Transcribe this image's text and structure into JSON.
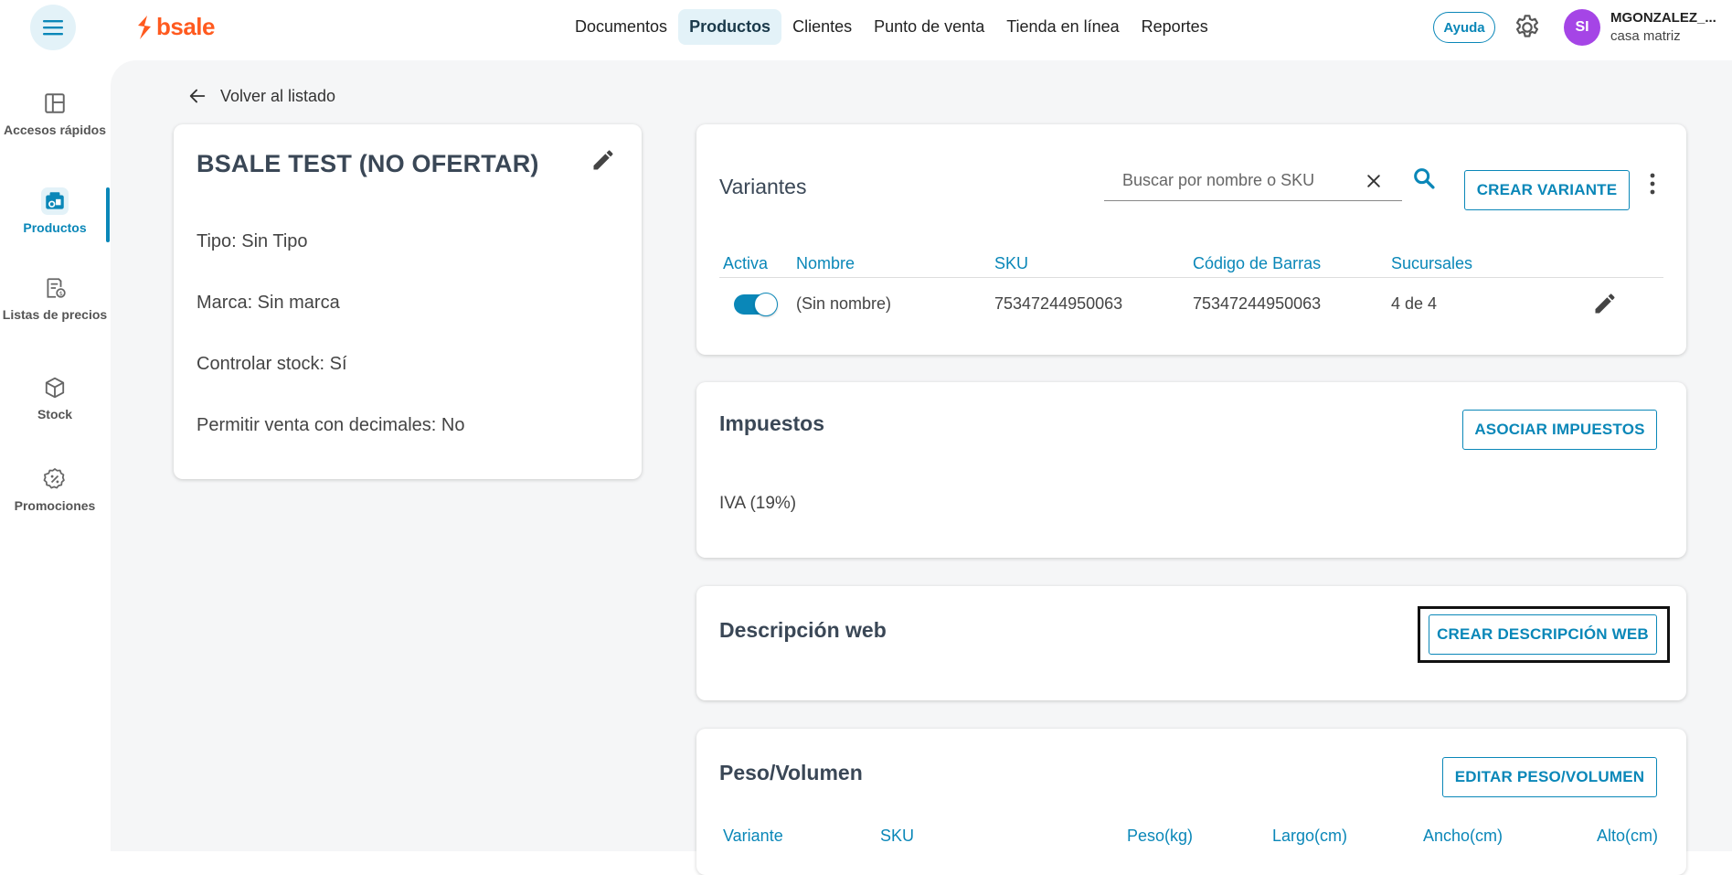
{
  "app": {
    "logo_text": "bsale",
    "brand_color": "#ff5a1f",
    "accent_color": "#0a87b8"
  },
  "topnav": {
    "items": [
      "Documentos",
      "Productos",
      "Clientes",
      "Punto de venta",
      "Tienda en línea",
      "Reportes"
    ],
    "active": "Productos"
  },
  "header": {
    "help_label": "Ayuda",
    "avatar_initials": "SI",
    "user_name": "MGONZALEZ_...",
    "user_branch": "casa matriz"
  },
  "sidebar": {
    "items": [
      {
        "label": "Accesos rápidos",
        "icon": "layout-icon"
      },
      {
        "label": "Productos",
        "icon": "products-icon",
        "active": true
      },
      {
        "label": "Listas de precios",
        "icon": "price-list-icon"
      },
      {
        "label": "Stock",
        "icon": "box-icon"
      },
      {
        "label": "Promociones",
        "icon": "discount-icon"
      }
    ]
  },
  "back": {
    "label": "Volver al listado"
  },
  "product": {
    "title": "BSALE TEST (NO OFERTAR)",
    "props": [
      "Tipo: Sin Tipo",
      "Marca: Sin marca",
      "Controlar stock: Sí",
      "Permitir venta con decimales: No"
    ]
  },
  "variants": {
    "title": "Variantes",
    "search_placeholder": "Buscar por nombre o SKU",
    "create_label": "CREAR VARIANTE",
    "columns": [
      "Activa",
      "Nombre",
      "SKU",
      "Código de Barras",
      "Sucursales"
    ],
    "rows": [
      {
        "active": true,
        "name": "(Sin nombre)",
        "sku": "75347244950063",
        "barcode": "75347244950063",
        "branches": "4 de 4"
      }
    ]
  },
  "taxes": {
    "title": "Impuestos",
    "button_label": "ASOCIAR IMPUESTOS",
    "items": [
      "IVA (19%)"
    ]
  },
  "web_description": {
    "title": "Descripción web",
    "button_label": "CREAR DESCRIPCIÓN WEB"
  },
  "weight": {
    "title": "Peso/Volumen",
    "button_label": "EDITAR PESO/VOLUMEN",
    "columns": [
      "Variante",
      "SKU",
      "Peso(kg)",
      "Largo(cm)",
      "Ancho(cm)",
      "Alto(cm)"
    ]
  }
}
